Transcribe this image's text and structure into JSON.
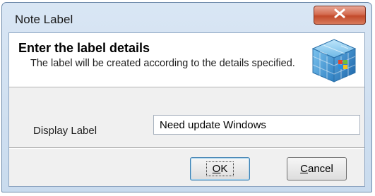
{
  "window": {
    "title": "Note Label"
  },
  "header": {
    "title": "Enter the label details",
    "description": "The label will be created according to the details specified."
  },
  "form": {
    "display_label": {
      "label": "Display Label",
      "value": "Need update Windows"
    }
  },
  "buttons": {
    "ok": {
      "mnemonic": "O",
      "rest": "K"
    },
    "cancel": {
      "mnemonic": "C",
      "rest": "ancel"
    }
  },
  "icons": {
    "close": "close-icon",
    "header": "windows-cube-icon"
  },
  "colors": {
    "close_button": "#c94f30",
    "frame": "#c9dbee",
    "client": "#f0f0f0"
  }
}
